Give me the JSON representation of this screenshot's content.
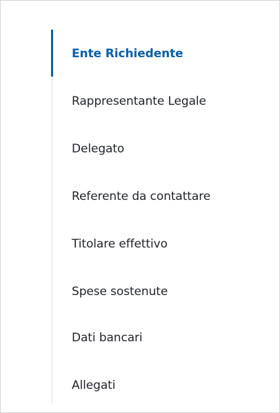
{
  "sidebar": {
    "items": [
      {
        "label": "Ente Richiedente",
        "active": true
      },
      {
        "label": "Rappresentante Legale",
        "active": false
      },
      {
        "label": "Delegato",
        "active": false
      },
      {
        "label": "Referente da contattare",
        "active": false
      },
      {
        "label": "Titolare effettivo",
        "active": false
      },
      {
        "label": "Spese sostenute",
        "active": false
      },
      {
        "label": "Dati bancari",
        "active": false
      },
      {
        "label": "Allegati",
        "active": false
      }
    ],
    "colors": {
      "active_text": "#0b5fa5",
      "active_indicator": "#0b5fa5",
      "text": "#1f2328",
      "rail": "#d7dce0"
    }
  }
}
